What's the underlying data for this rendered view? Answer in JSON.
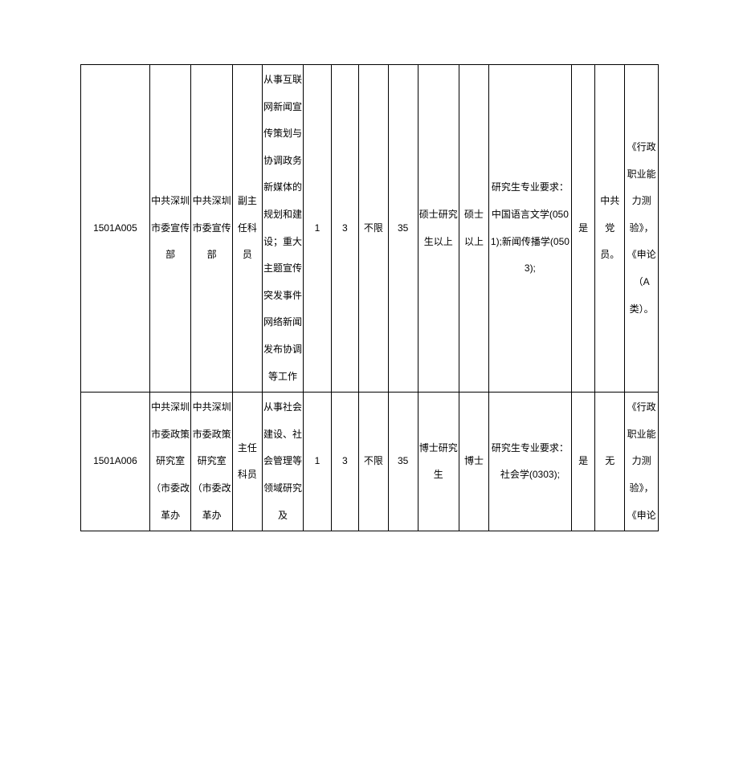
{
  "rows": [
    {
      "code": "1501A005",
      "org": "中共深圳市委宣传部",
      "dept": "中共深圳市委宣传部",
      "position": "副主任科员",
      "desc": "从事互联网新闻宣传策划与协调政务新媒体的规划和建设；重大主题宣传突发事件网络新闻发布协调等工作",
      "num": "1",
      "ratio": "3",
      "gender": "不限",
      "age": "35",
      "edu": "硕士研究生以上",
      "degree": "硕士以上",
      "major": "研究生专业要求：中国语言文学(0501);新闻传播学(0503);",
      "yn": "是",
      "other": "中共党员。",
      "exam": "《行政职业能力测验》，《申论（A类）。"
    },
    {
      "code": "1501A006",
      "org": "中共深圳市委政策研究室（市委改革办",
      "dept": "中共深圳市委政策研究室（市委改革办",
      "position": "主任科员",
      "desc": "从事社会建设、社会管理等领域研究及",
      "num": "1",
      "ratio": "3",
      "gender": "不限",
      "age": "35",
      "edu": "博士研究生",
      "degree": "博士",
      "major": "研究生专业要求：社会学(0303);",
      "yn": "是",
      "other": "无",
      "exam": "《行政职业能力测验》，《申论"
    }
  ]
}
